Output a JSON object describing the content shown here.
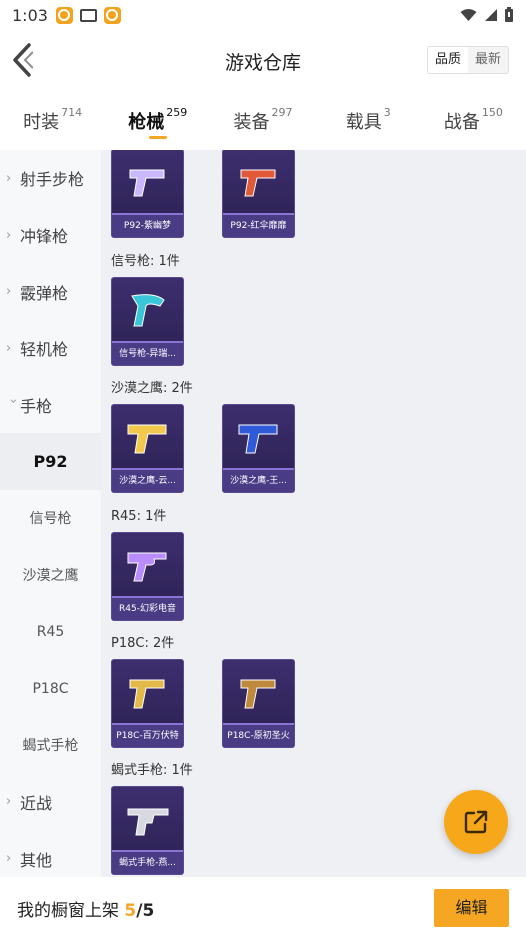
{
  "status_bar": {
    "time": "1:03",
    "icons": [
      "app-icon",
      "mail-icon",
      "app-icon",
      "wifi-icon",
      "signal-icon",
      "battery-icon"
    ]
  },
  "header": {
    "title": "游戏仓库",
    "sort": {
      "options": [
        "品质",
        "最新"
      ],
      "active": "品质"
    }
  },
  "tabs": [
    {
      "label": "时装",
      "count": "714",
      "active": false
    },
    {
      "label": "枪械",
      "count": "259",
      "active": true
    },
    {
      "label": "装备",
      "count": "297",
      "active": false
    },
    {
      "label": "载具",
      "count": "3",
      "active": false
    },
    {
      "label": "战备",
      "count": "150",
      "active": false
    }
  ],
  "sidebar": {
    "items": [
      {
        "label": "射手步枪",
        "expanded": false
      },
      {
        "label": "冲锋枪",
        "expanded": false
      },
      {
        "label": "霰弹枪",
        "expanded": false
      },
      {
        "label": "轻机枪",
        "expanded": false
      },
      {
        "label": "手枪",
        "expanded": true
      }
    ],
    "subitems": [
      {
        "label": "P92",
        "active": true
      },
      {
        "label": "信号枪",
        "active": false
      },
      {
        "label": "沙漠之鹰",
        "active": false
      },
      {
        "label": "R45",
        "active": false
      },
      {
        "label": "P18C",
        "active": false
      },
      {
        "label": "蝎式手枪",
        "active": false
      }
    ],
    "after": [
      {
        "label": "近战",
        "expanded": false
      },
      {
        "label": "其他",
        "expanded": false
      }
    ]
  },
  "groups": [
    {
      "title": "",
      "items": [
        {
          "name": "P92-紫幽梦",
          "accent": "#c9b7ff"
        },
        {
          "name": "P92-红伞靡靡",
          "accent": "#e05a3a"
        }
      ]
    },
    {
      "title": "信号枪: 1件",
      "items": [
        {
          "name": "信号枪-异瑞...",
          "accent": "#39c6d9"
        }
      ]
    },
    {
      "title": "沙漠之鹰: 2件",
      "items": [
        {
          "name": "沙漠之鹰-云...",
          "accent": "#f2c94c"
        },
        {
          "name": "沙漠之鹰-王...",
          "accent": "#2f5bd8"
        }
      ]
    },
    {
      "title": "R45: 1件",
      "items": [
        {
          "name": "R45-幻彩电音",
          "accent": "#b98cff"
        }
      ]
    },
    {
      "title": "P18C: 2件",
      "items": [
        {
          "name": "P18C-百万伏特",
          "accent": "#e3b94a"
        },
        {
          "name": "P18C-原初圣火",
          "accent": "#c08a3e"
        }
      ]
    },
    {
      "title": "蝎式手枪: 1件",
      "items": [
        {
          "name": "蝎式手枪-燕...",
          "accent": "#d8d8e0"
        }
      ]
    }
  ],
  "bottom_bar": {
    "label": "我的橱窗上架",
    "current": "5",
    "separator": "/",
    "total": "5",
    "edit_label": "编辑"
  },
  "colors": {
    "accent": "#f5a623",
    "card_bg": "#2f2558"
  }
}
